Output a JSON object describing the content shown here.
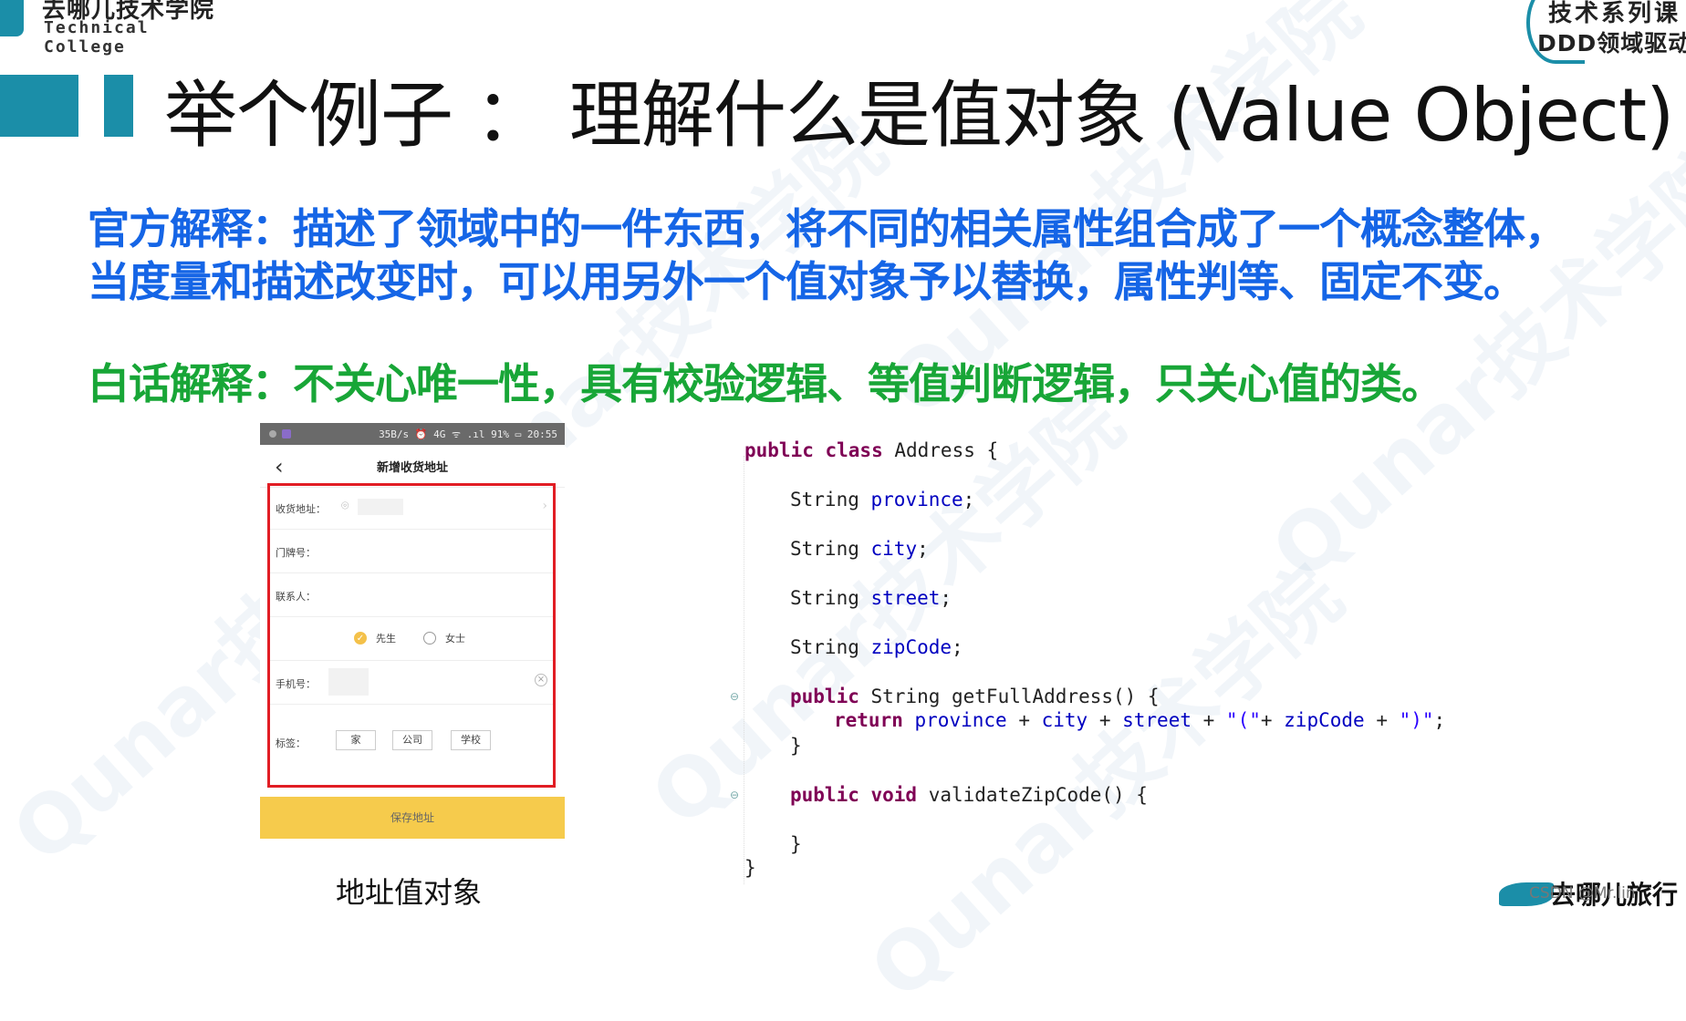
{
  "header": {
    "logo_cn": "去哪儿技术学院",
    "logo_en": "Technical College",
    "series_top": "技术系列课",
    "series_bottom": "DDD领域驱动"
  },
  "slide": {
    "title": "举个例子 ： 理解什么是值对象 (Value Object)",
    "official_line1": "官方解释：描述了领域中的一件东西，将不同的相关属性组合成了一个概念整体，",
    "official_line2": "当度量和描述改变时，可以用另外一个值对象予以替换，属性判等、固定不变。",
    "plain": "白话解释：不关心唯一性，具有校验逻辑、等值判断逻辑，只关心值的类。",
    "caption": "地址值对象",
    "watermark": "Qunar技术学院"
  },
  "phone": {
    "status": "35B/s ⏰ 4G ᯤ .ıl 91% ▭ 20:55",
    "title": "新增收货地址",
    "fields": {
      "address": "收货地址：",
      "door": "门牌号：",
      "contact": "联系人：",
      "mr": "先生",
      "ms": "女士",
      "phone": "手机号：",
      "tags": "标签：",
      "tag_home": "家",
      "tag_company": "公司",
      "tag_school": "学校"
    },
    "save": "保存地址"
  },
  "code": {
    "l1_kw": "public class",
    "l1_rest": " Address {",
    "l2_type": "String ",
    "l2_field": "province",
    "l3_type": "String ",
    "l3_field": "city",
    "l4_type": "String ",
    "l4_field": "street",
    "l5_type": "String ",
    "l5_field": "zipCode",
    "l6_kw": "public",
    "l6_rest": " String getFullAddress() {",
    "l7_kw": "return",
    "l7_f1": "province",
    "l7_f2": "city",
    "l7_f3": "street",
    "l7_s1": "\"(\"",
    "l7_f4": "zipCode",
    "l7_s2": "\")\"",
    "l8": "}",
    "l9_kw": "public void",
    "l9_rest": " validateZipCode() {",
    "l10": "}",
    "l11": "}"
  },
  "footer": {
    "logo_text": "去哪儿旅行",
    "csdn": "CSDN @Mr.lin"
  }
}
